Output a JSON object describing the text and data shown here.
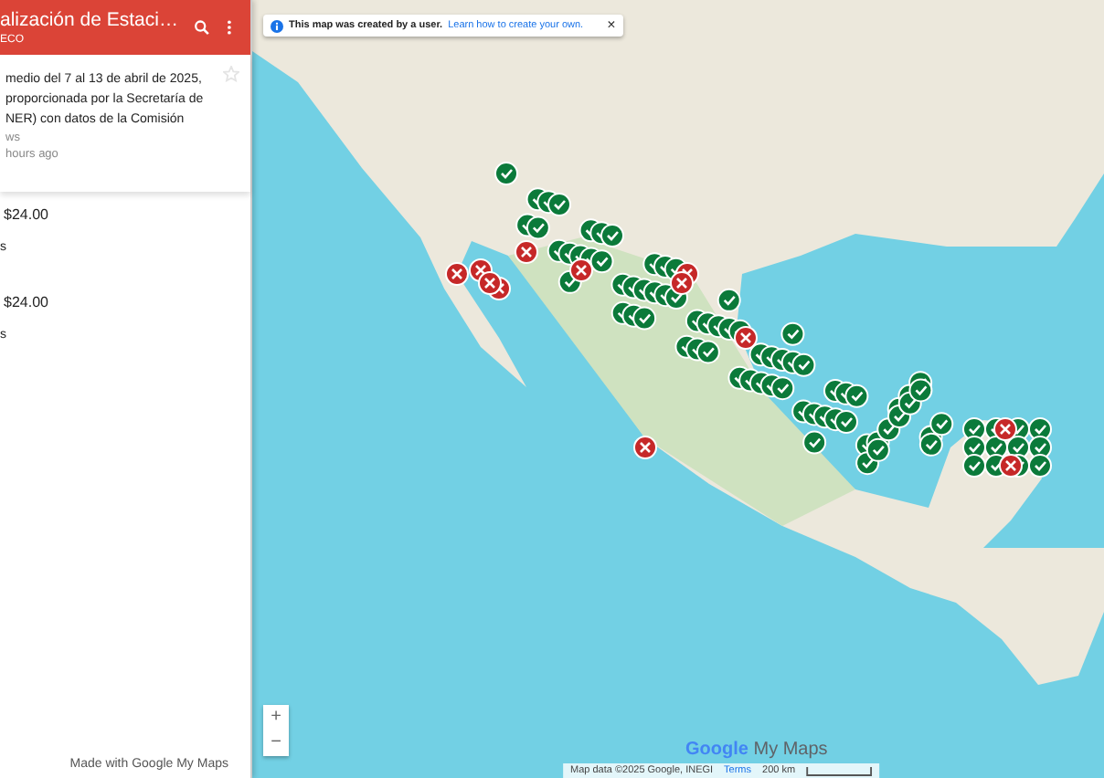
{
  "sidebar": {
    "title": "alización de Estaci…",
    "subtitle": "ECO",
    "description_lines": [
      "medio del 7 al 13 de abril de 2025,",
      "proporcionada por la Secretaría de",
      "NER) con datos de la Comisión"
    ],
    "views": "ws",
    "updated": "hours ago",
    "items": [
      {
        "price": "$24.00",
        "detail": "s"
      },
      {
        "price": "$24.00",
        "detail": "s"
      }
    ],
    "footer": "Made with Google My Maps"
  },
  "map": {
    "banner": {
      "text": "This map was created by a user.",
      "link": "Learn how to create your own.",
      "close": "×"
    },
    "zoom_in": "+",
    "zoom_out": "−",
    "attribution": "Map data ©2025 Google, INEGI",
    "terms": "Terms",
    "scale": "200 km",
    "logo_google": "Google",
    "logo_product": "My Maps"
  }
}
